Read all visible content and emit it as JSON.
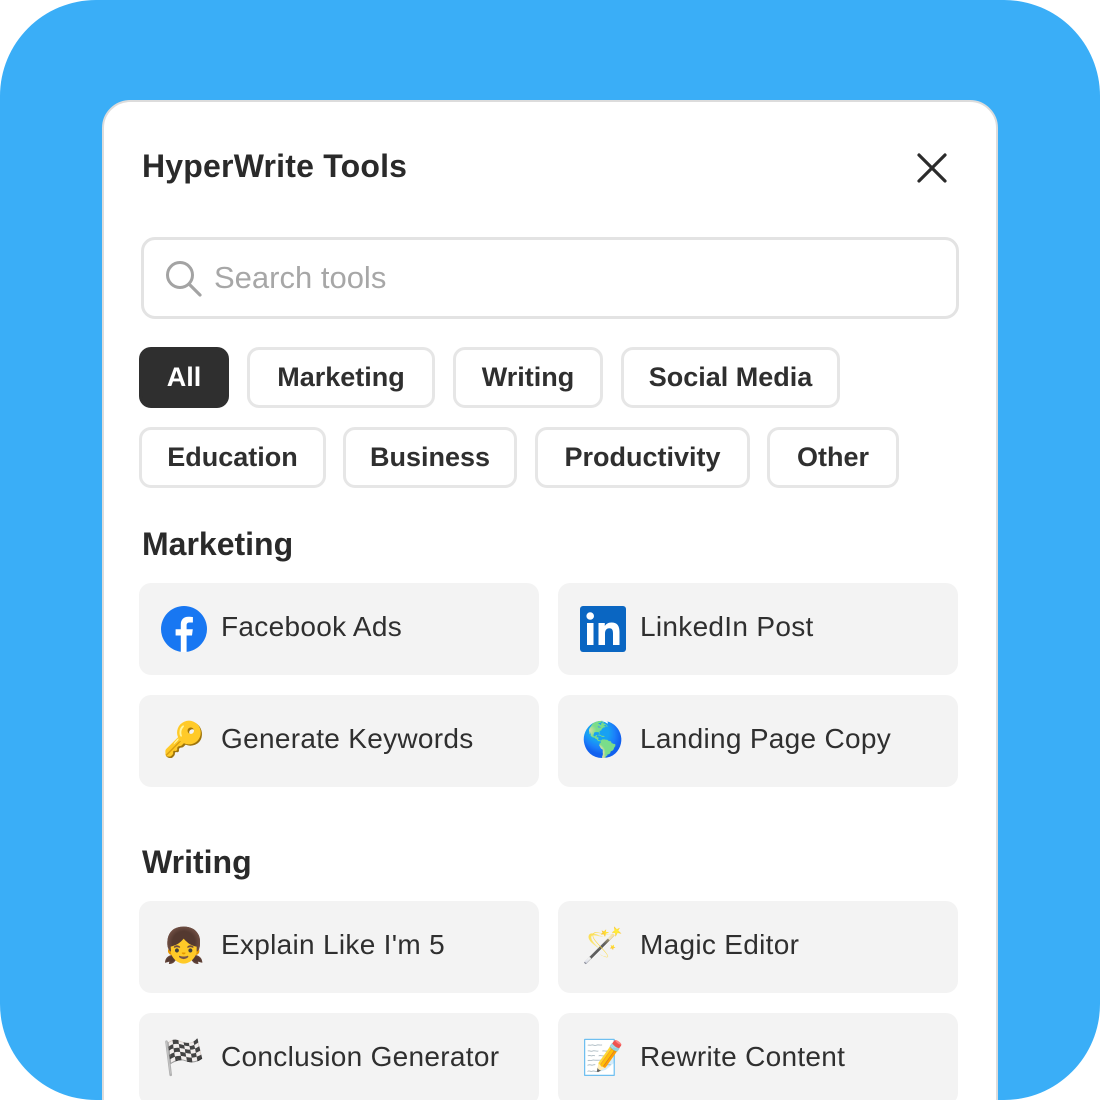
{
  "header": {
    "title": "HyperWrite Tools"
  },
  "search": {
    "placeholder": "Search tools",
    "value": ""
  },
  "filters": [
    {
      "label": "All",
      "active": true
    },
    {
      "label": "Marketing",
      "active": false
    },
    {
      "label": "Writing",
      "active": false
    },
    {
      "label": "Social Media",
      "active": false
    },
    {
      "label": "Education",
      "active": false
    },
    {
      "label": "Business",
      "active": false
    },
    {
      "label": "Productivity",
      "active": false
    },
    {
      "label": "Other",
      "active": false
    }
  ],
  "sections": [
    {
      "title": "Marketing",
      "tools": [
        {
          "label": "Facebook Ads",
          "icon": "facebook-icon"
        },
        {
          "label": "LinkedIn Post",
          "icon": "linkedin-icon"
        },
        {
          "label": "Generate Keywords",
          "icon": "key-icon",
          "emoji": "🔑"
        },
        {
          "label": "Landing Page Copy",
          "icon": "globe-icon",
          "emoji": "🌎"
        }
      ]
    },
    {
      "title": "Writing",
      "tools": [
        {
          "label": "Explain Like I'm 5",
          "icon": "girl-icon",
          "emoji": "👧"
        },
        {
          "label": "Magic Editor",
          "icon": "magic-wand-icon",
          "emoji": "🪄"
        },
        {
          "label": "Conclusion Generator",
          "icon": "checkered-flag-icon",
          "emoji": "🏁"
        },
        {
          "label": "Rewrite Content",
          "icon": "memo-icon",
          "emoji": "📝"
        }
      ]
    }
  ],
  "colors": {
    "background": "#3aaef7",
    "active_chip": "#2f2f2f",
    "card": "#f3f3f3",
    "facebook": "#1877f2",
    "linkedin": "#0a66c2"
  }
}
